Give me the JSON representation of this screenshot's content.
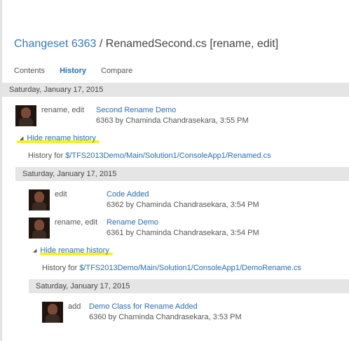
{
  "header": {
    "changeset_label": "Changeset 6363",
    "separator": " / ",
    "file_title": "RenamedSecond.cs [rename, edit]"
  },
  "tabs": [
    "Contents",
    "History",
    "Compare"
  ],
  "level1": {
    "date": "Saturday, January 17, 2015",
    "changesets": [
      {
        "type": "rename, edit",
        "title": "Second Rename Demo",
        "meta": "6363 by Chaminda Chandrasekara, 3:55 PM"
      }
    ],
    "toggle": "Hide rename history",
    "history_prefix": "History for ",
    "history_path": "$/TFS2013Demo/Main/Solution1/ConsoleApp1/Renamed.cs"
  },
  "level2": {
    "date": "Saturday, January 17, 2015",
    "changesets": [
      {
        "type": "edit",
        "title": "Code Added",
        "meta": "6362 by Chaminda Chandrasekara, 3:54 PM"
      },
      {
        "type": "rename, edit",
        "title": "Rename Demo",
        "meta": "6361 by Chaminda Chandrasekara, 3:54 PM"
      }
    ],
    "toggle": "Hide rename history",
    "history_prefix": "History for ",
    "history_path": "$/TFS2013Demo/Main/Solution1/ConsoleApp1/DemoRename.cs"
  },
  "level3": {
    "date": "Saturday, January 17, 2015",
    "changesets": [
      {
        "type": "add",
        "title": "Demo Class for Rename Added",
        "meta": "6360 by Chaminda Chandrasekara, 3:53 PM"
      }
    ]
  },
  "colors": {
    "link": "#2a6cb0",
    "highlight": "#f4f02a",
    "date_bar": "#e5e5e5"
  }
}
